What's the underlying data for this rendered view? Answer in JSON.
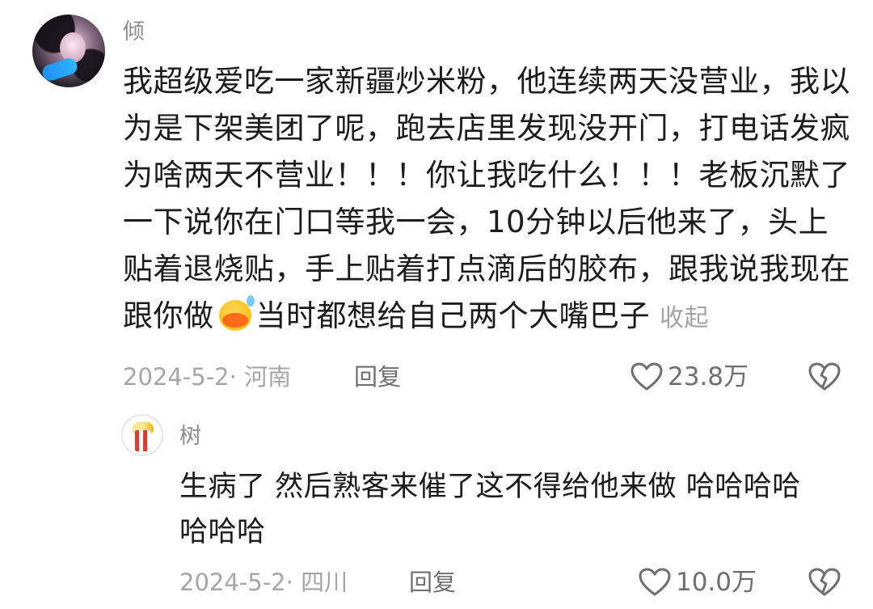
{
  "main_comment": {
    "username": "倾",
    "text_lines": [
      "我超级爱吃一家新疆炒米粉，他连续两天没营业，我以",
      "为是下架美团了呢，跑去店里发现没开门，打电话发疯",
      "为啥两天不营业！！！你让我吃什么！！！老板沉默了",
      "一下说你在门口等我一会，10分钟以后他来了，头上",
      "贴着退烧贴，手上贴着打点滴后的胶布，跟我说我现在"
    ],
    "last_line_before_emoji": "跟你做",
    "emoji": "duck-sweat-emoji",
    "last_line_after_emoji": "当时都想给自己两个大嘴巴子",
    "collapse_label": "收起",
    "date_location": "2024-5-2· 河南",
    "reply_label": "回复",
    "like_count": "23.8万"
  },
  "reply_comment": {
    "username": "树",
    "text_lines": [
      "生病了 然后熟客来催了这不得给他来做 哈哈哈哈",
      "哈哈哈"
    ],
    "date_location": "2024-5-2· 四川",
    "reply_label": "回复",
    "like_count": "10.0万"
  },
  "icons": {
    "like": "heart-outline-icon",
    "dislike": "broken-heart-icon"
  },
  "colors": {
    "text_primary": "#1c1c1c",
    "text_secondary": "#a6a6a6",
    "username": "#8d8d8d",
    "action": "#6f6f6f"
  }
}
